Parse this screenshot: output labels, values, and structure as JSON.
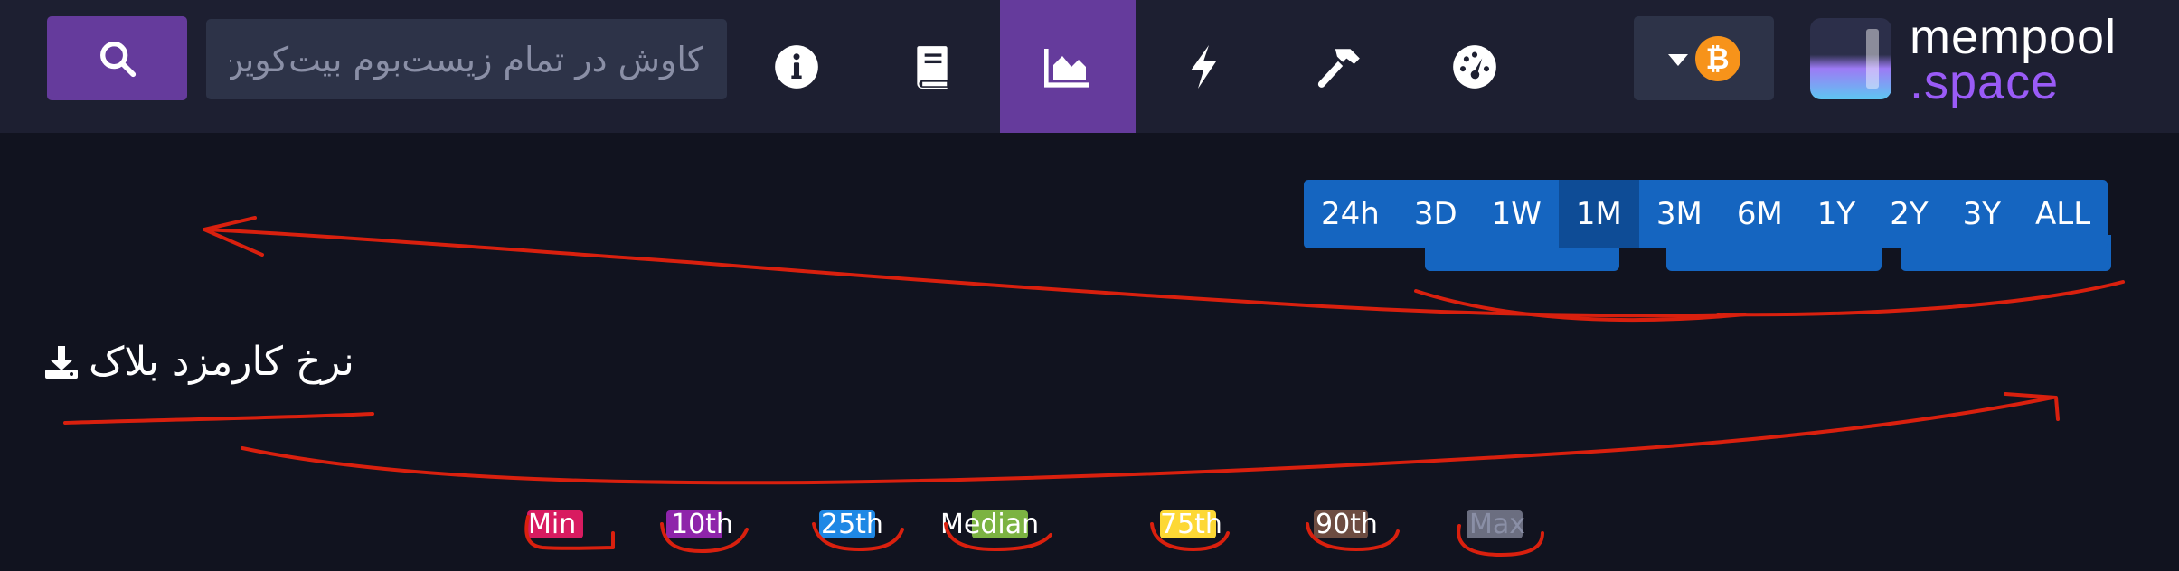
{
  "search": {
    "placeholder": "کاوش در تمام زیست‌بوم بیت‌کوین"
  },
  "nav": {
    "items": [
      {
        "icon": "info-icon",
        "active": false
      },
      {
        "icon": "book-icon",
        "active": false
      },
      {
        "icon": "chart-area-icon",
        "active": true
      },
      {
        "icon": "lightning-icon",
        "active": false
      },
      {
        "icon": "hammer-icon",
        "active": false
      },
      {
        "icon": "dashboard-gauge-icon",
        "active": false
      }
    ]
  },
  "currency": {
    "icon": "bitcoin-icon",
    "symbol": "₿"
  },
  "logo": {
    "line1": "mempool",
    "line2": ".space"
  },
  "time_range": {
    "options": [
      "24h",
      "3D",
      "1W",
      "1M",
      "3M",
      "6M",
      "1Y",
      "2Y",
      "3Y",
      "ALL"
    ],
    "selected": "1M"
  },
  "chart": {
    "title": "نرخ کارمزد بلاک",
    "download_icon": "download-icon"
  },
  "legend": {
    "items": [
      {
        "label": "Min",
        "color": "#d81b60"
      },
      {
        "label": "10th",
        "color": "#8e24aa"
      },
      {
        "label": "25th",
        "color": "#1e88e5"
      },
      {
        "label": "Median",
        "color": "#7cb342"
      },
      {
        "label": "75th",
        "color": "#fdd835"
      },
      {
        "label": "90th",
        "color": "#6d4c41"
      },
      {
        "label": "Max",
        "color": "#6b6e80"
      }
    ]
  },
  "colors": {
    "navbar_bg": "#1d1f31",
    "page_bg": "#11131f",
    "accent_purple": "#653b9c",
    "range_blue": "#1565c0",
    "annotation_red": "#d9200e"
  }
}
